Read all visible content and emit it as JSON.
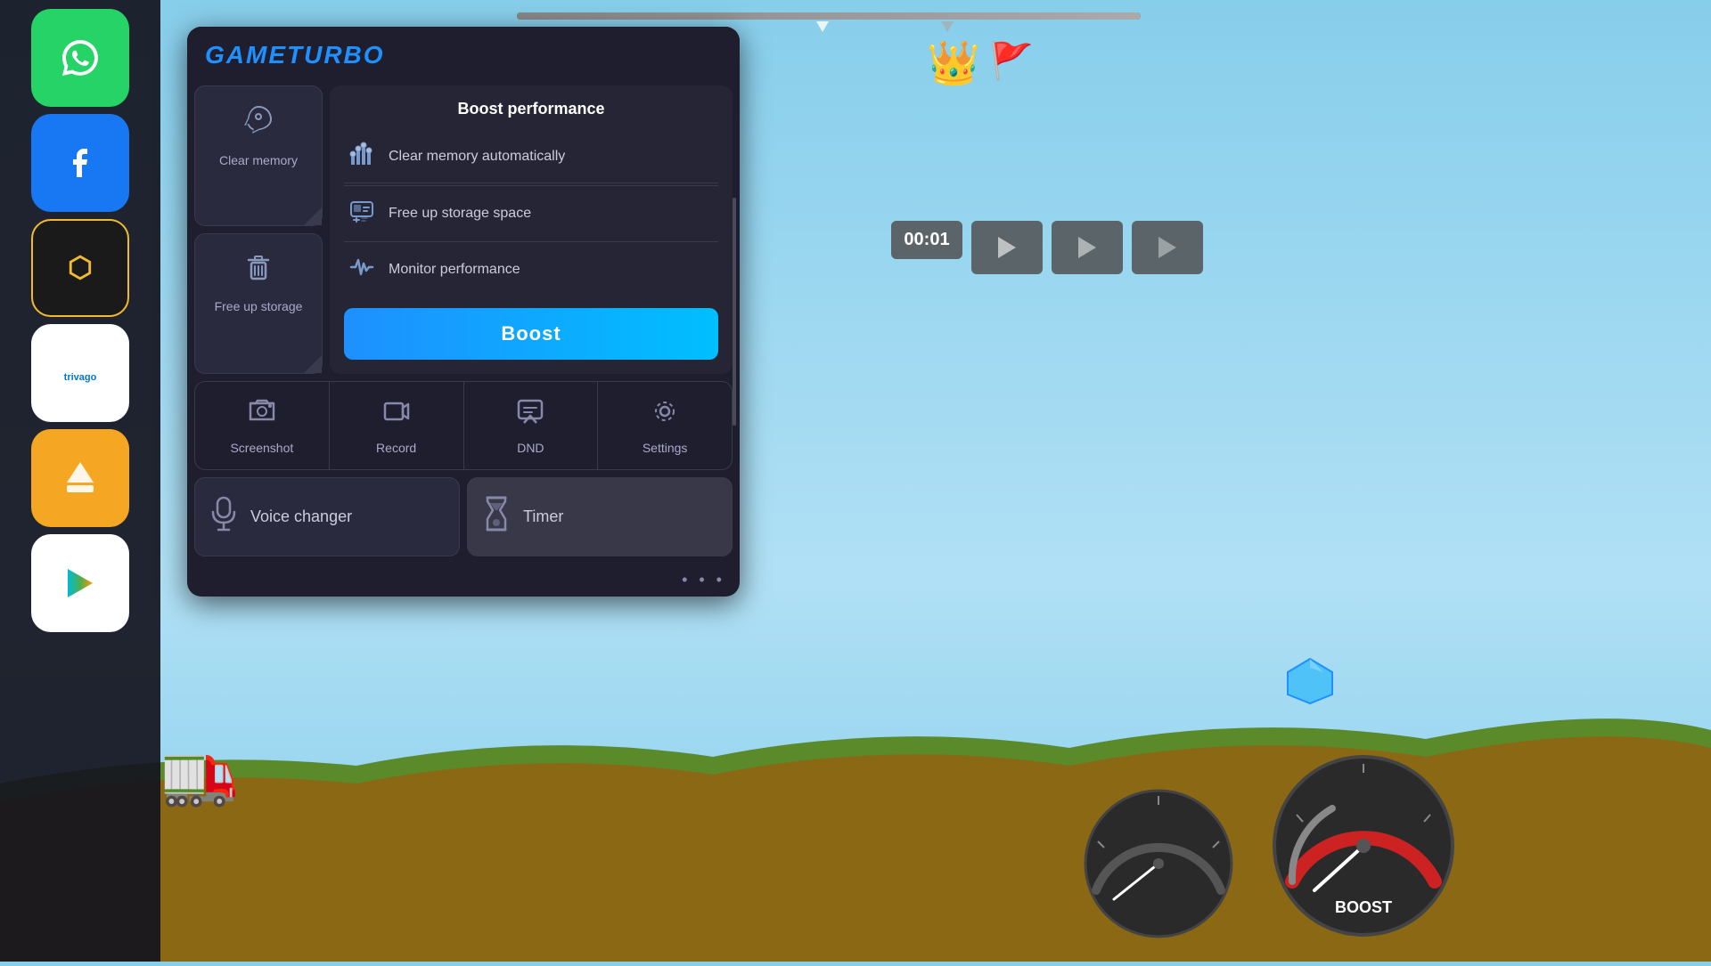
{
  "app": {
    "title": "GAMETURBO"
  },
  "game": {
    "timer": "00:01",
    "progress_percent": 50
  },
  "quick_actions": [
    {
      "id": "clear-memory",
      "label": "Clear memory",
      "icon": "rocket"
    },
    {
      "id": "free-up-storage",
      "label": "Free up storage",
      "icon": "trash"
    }
  ],
  "boost_panel": {
    "title": "Boost performance",
    "items": [
      {
        "id": "clear-memory-auto",
        "label": "Clear memory automatically",
        "icon": "equalizer"
      },
      {
        "id": "free-up-storage-space",
        "label": "Free up storage space",
        "icon": "cloud-download"
      },
      {
        "id": "monitor-performance",
        "label": "Monitor performance",
        "icon": "activity"
      }
    ],
    "boost_button_label": "Boost"
  },
  "tools": [
    {
      "id": "screenshot",
      "label": "Screenshot",
      "icon": "📷"
    },
    {
      "id": "record",
      "label": "Record",
      "icon": "🎬"
    },
    {
      "id": "dnd",
      "label": "DND",
      "icon": "💬"
    },
    {
      "id": "settings",
      "label": "Settings",
      "icon": "⚙️"
    }
  ],
  "extra_tools": [
    {
      "id": "voice-changer",
      "label": "Voice changer",
      "icon": "🎤"
    },
    {
      "id": "timer",
      "label": "Timer",
      "icon": "⏳"
    }
  ],
  "sidebar_apps": [
    {
      "id": "whatsapp",
      "label": "WhatsApp",
      "emoji": "📱",
      "color": "#25D366"
    },
    {
      "id": "facebook",
      "label": "Facebook",
      "emoji": "f",
      "color": "#1877F2"
    },
    {
      "id": "binance",
      "label": "Binance",
      "emoji": "◈",
      "color": "#1a1a1a"
    },
    {
      "id": "trivago",
      "label": "Trivago",
      "emoji": "trivago",
      "color": "#ffffff"
    },
    {
      "id": "orange-app",
      "label": "App",
      "emoji": "🏷️",
      "color": "#F5A623"
    },
    {
      "id": "play-store",
      "label": "Play Store",
      "emoji": "▶",
      "color": "#ffffff"
    }
  ],
  "colors": {
    "accent_blue": "#1e90ff",
    "panel_bg": "#1e1e2e",
    "panel_section": "#252535",
    "button_bg": "#2a2a3e",
    "text_primary": "#ffffff",
    "text_secondary": "#ccccdd",
    "text_muted": "#8888aa"
  }
}
